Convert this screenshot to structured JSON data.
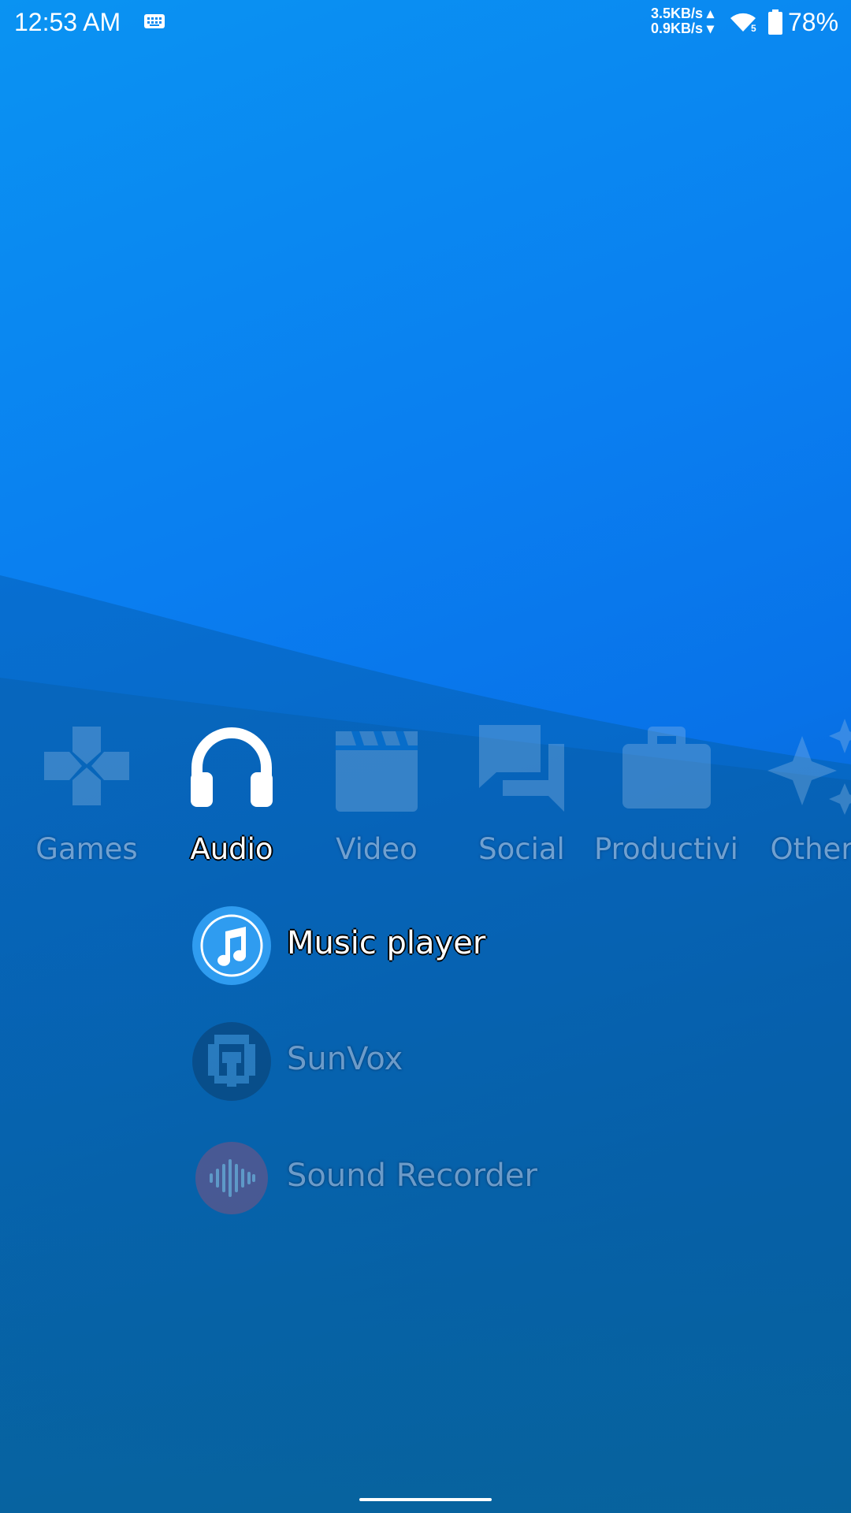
{
  "status_bar": {
    "time": "12:53 AM",
    "upload_speed": "3.5KB/s ▴",
    "download_speed": "0.9KB/s ▾",
    "wifi_badge": "5",
    "battery_percent": "78%",
    "icons": [
      "keyboard-icon",
      "wifi-icon",
      "battery-icon"
    ]
  },
  "categories": [
    {
      "label": "Games",
      "icon": "gamepad-icon",
      "active": false
    },
    {
      "label": "Audio",
      "icon": "headphones-icon",
      "active": true
    },
    {
      "label": "Video",
      "icon": "clapperboard-icon",
      "active": false
    },
    {
      "label": "Social",
      "icon": "chat-bubbles-icon",
      "active": false
    },
    {
      "label": "Productivity",
      "icon": "briefcase-icon",
      "active": false
    },
    {
      "label": "Other",
      "icon": "sparkles-icon",
      "active": false
    }
  ],
  "apps": [
    {
      "label": "Music player",
      "icon": "music-note-icon",
      "active": true
    },
    {
      "label": "SunVox",
      "icon": "sunvox-icon",
      "active": false
    },
    {
      "label": "Sound Recorder",
      "icon": "sound-wave-icon",
      "active": false
    }
  ],
  "colors": {
    "background_top": "#0a93f2",
    "background_bottom": "#075a9c",
    "music_icon": "#2f9cf0"
  }
}
